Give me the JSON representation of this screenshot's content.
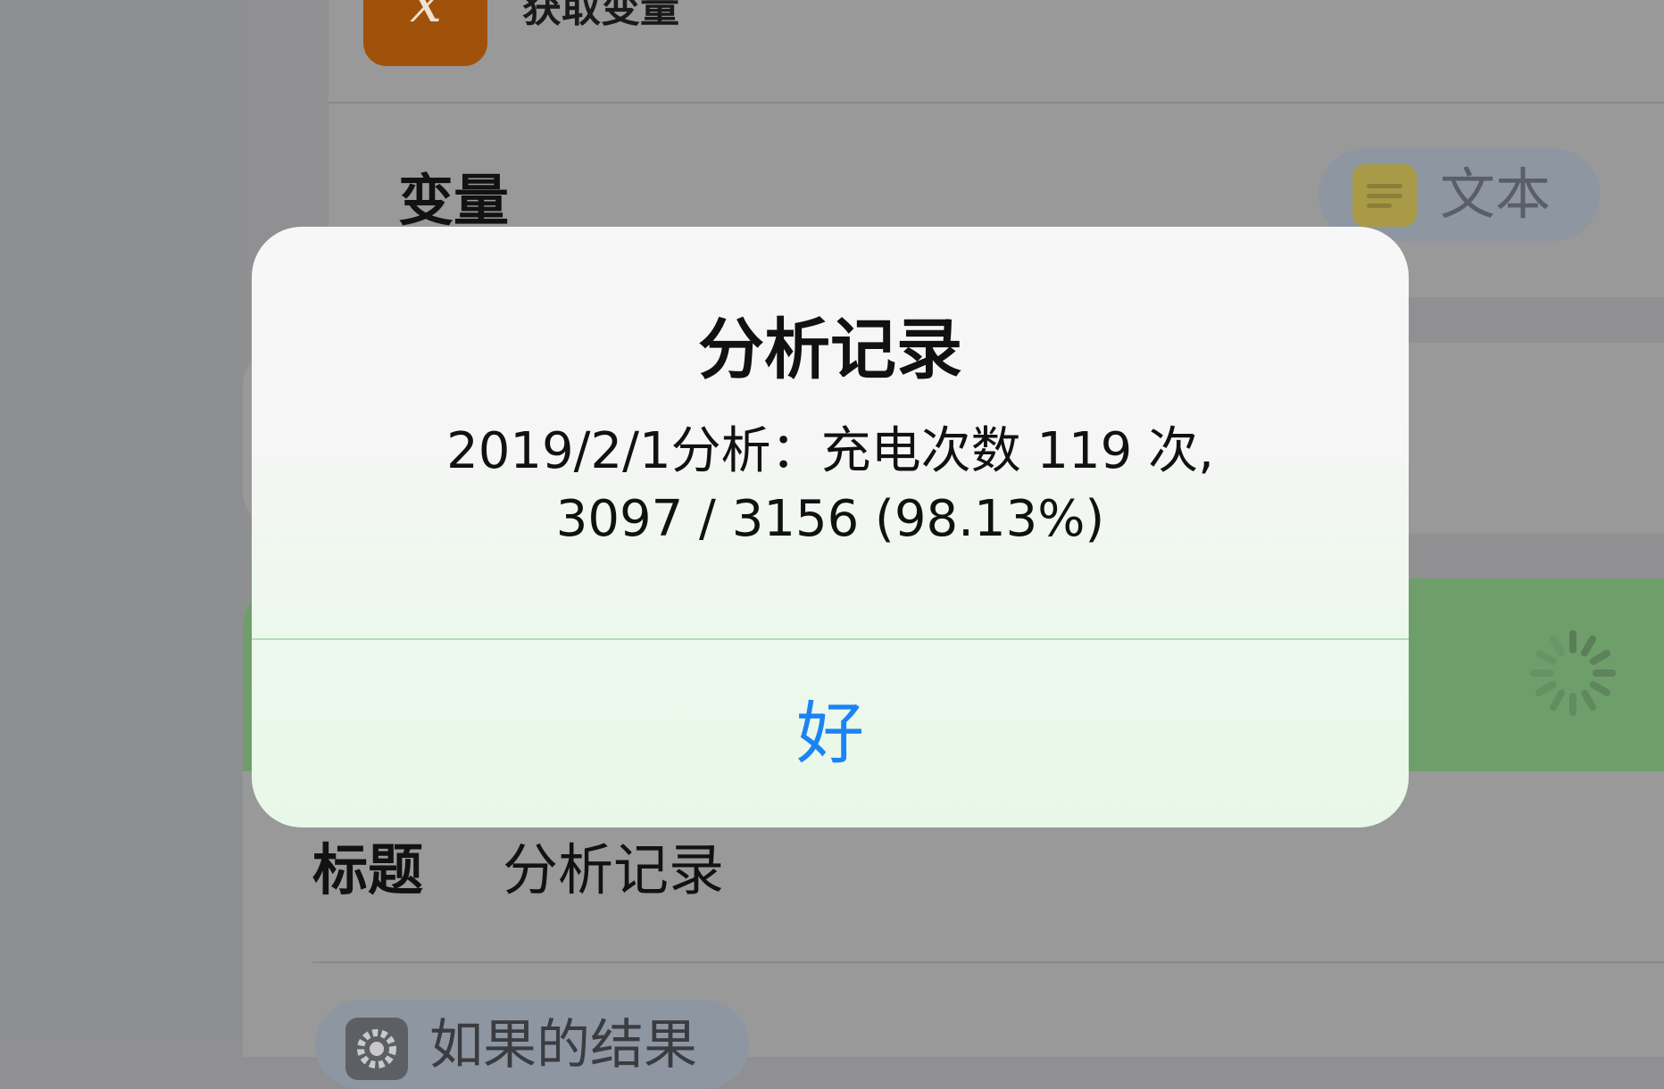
{
  "action": {
    "title": "获取变量",
    "icon": "variable-x-icon",
    "icon_color": "#a0510a"
  },
  "variable_row": {
    "label": "变量",
    "value": "文本",
    "value_icon": "text-lines-icon"
  },
  "alert": {
    "title": "分析记录",
    "message_line1": "2019/2/1分析：充电次数 119 次,",
    "message_line2": "3097 / 3156 (98.13%)",
    "button_label": "好",
    "button_color": "#1a84f5"
  },
  "show_alert_action": {
    "title_label": "标题",
    "title_value": "分析记录",
    "pill_label": "如果的结果",
    "pill_icon": "gear-icon"
  },
  "running_indicator": "spinner-icon"
}
